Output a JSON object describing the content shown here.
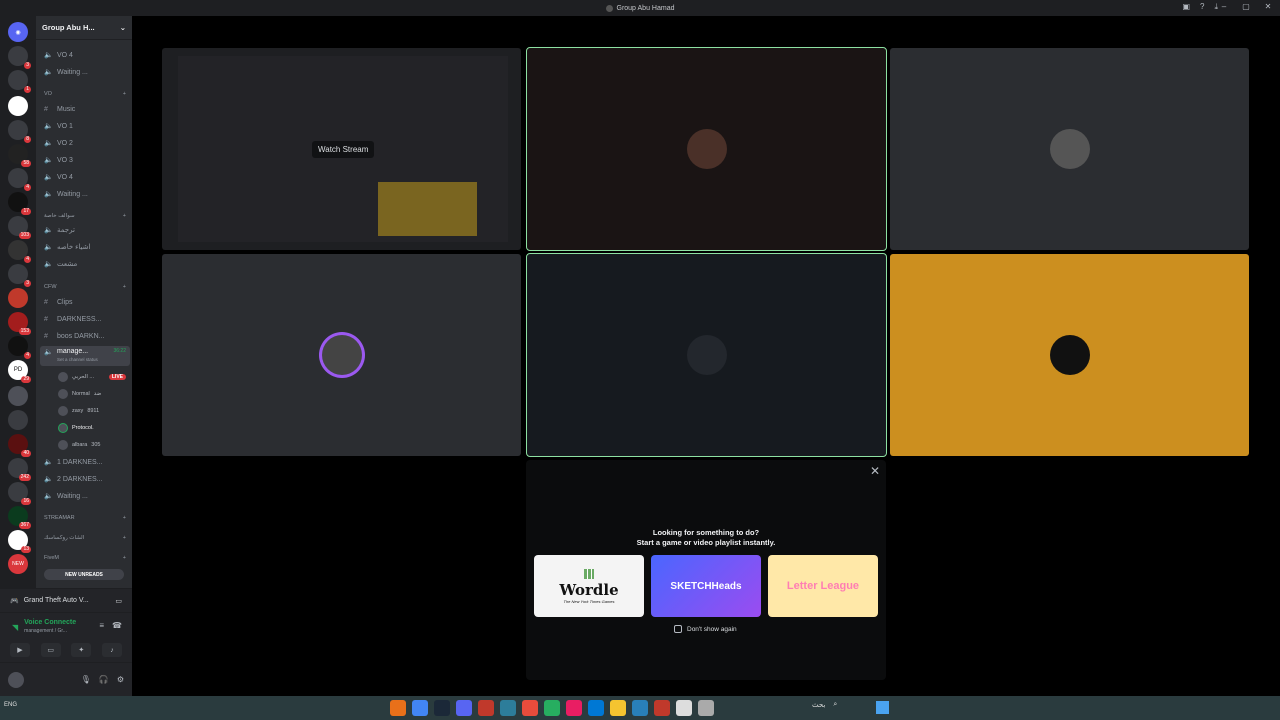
{
  "window": {
    "title": "Group Abu Hamad"
  },
  "server": {
    "name": "Group Abu H..."
  },
  "channels": [
    {
      "type": "voice",
      "label": "VO 4"
    },
    {
      "type": "voice",
      "label": "Waiting ..."
    },
    {
      "type": "category",
      "label": "VO"
    },
    {
      "type": "text",
      "label": "Music"
    },
    {
      "type": "voice",
      "label": "VO 1"
    },
    {
      "type": "voice",
      "label": "VO 2"
    },
    {
      "type": "voice",
      "label": "VO 3"
    },
    {
      "type": "voice",
      "label": "VO 4"
    },
    {
      "type": "voice",
      "label": "Waiting ..."
    },
    {
      "type": "category",
      "label": "سوالف خاصة"
    },
    {
      "type": "voice",
      "label": "ترجمة"
    },
    {
      "type": "voice",
      "label": "اشياء خاصه"
    },
    {
      "type": "voice",
      "label": "مشعت"
    },
    {
      "type": "category",
      "label": "CFW"
    },
    {
      "type": "text",
      "label": "Clips"
    },
    {
      "type": "text",
      "label": "DARKNESS..."
    },
    {
      "type": "text",
      "label": "boos DARKN..."
    },
    {
      "type": "voice",
      "label": "manage...",
      "time": "36:22",
      "active": true,
      "sub": "Set a channel status"
    },
    {
      "type": "voice",
      "label": "1 DARKNES..."
    },
    {
      "type": "voice",
      "label": "2 DARKNES..."
    },
    {
      "type": "voice",
      "label": "Waiting ..."
    },
    {
      "type": "category",
      "label": "STREAMAR"
    },
    {
      "type": "category",
      "label": "الشات روكساسك"
    },
    {
      "type": "category",
      "label": "FiveM"
    }
  ],
  "vc_users": [
    {
      "name": "الحربي ...",
      "live": "LIVE"
    },
    {
      "name": "Normal",
      "tag": "ضد"
    },
    {
      "name": "zaxy",
      "tag": "8911"
    },
    {
      "name": "Protocol.",
      "tag": ""
    },
    {
      "name": "albara",
      "tag": "305"
    }
  ],
  "new_unreads": "NEW UNREADS",
  "activity": {
    "label": "Grand Theft Auto V..."
  },
  "voice": {
    "status": "Voice Connecte",
    "channel": "management / Gr..."
  },
  "stage": {
    "watch_stream": "Watch Stream"
  },
  "prompt": {
    "line1": "Looking for something to do?",
    "line2": "Start a game or video playlist instantly.",
    "cards": [
      "Wordle",
      "SKETCHHeads",
      "Letter League"
    ],
    "wordle_sub": "The New York Times Games",
    "dont_show": "Don't show again"
  },
  "taskbar": {
    "left": "ENG",
    "search": "بحث"
  },
  "colors": {
    "accent": "#5865f2",
    "speaking": "#8de1a2",
    "bg_tile": "#2b2d31",
    "yellow_tile": "#cc8f1f",
    "green": "#23a55a",
    "live": "#da373c"
  }
}
